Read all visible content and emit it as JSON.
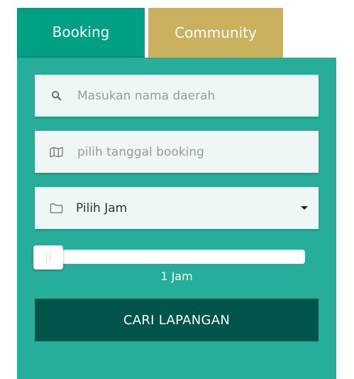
{
  "tabs": {
    "booking_label": "Booking",
    "community_label": "Community",
    "active": "booking"
  },
  "form": {
    "search": {
      "icon": "search-icon",
      "placeholder": "Masukan nama daerah",
      "value": ""
    },
    "date": {
      "icon": "map-icon",
      "placeholder": "pilih tanggal booking",
      "value": ""
    },
    "time": {
      "icon": "folder-icon",
      "selected": "Pilih Jam"
    },
    "duration": {
      "value_label": "1 Jam",
      "value": 1
    },
    "submit_label": "CARI LAPANGAN"
  },
  "colors": {
    "tab_booking": "#00a085",
    "tab_community": "#c9b15e",
    "panel": "#27ae9a",
    "field": "#eef7f5",
    "button": "#00544a"
  }
}
